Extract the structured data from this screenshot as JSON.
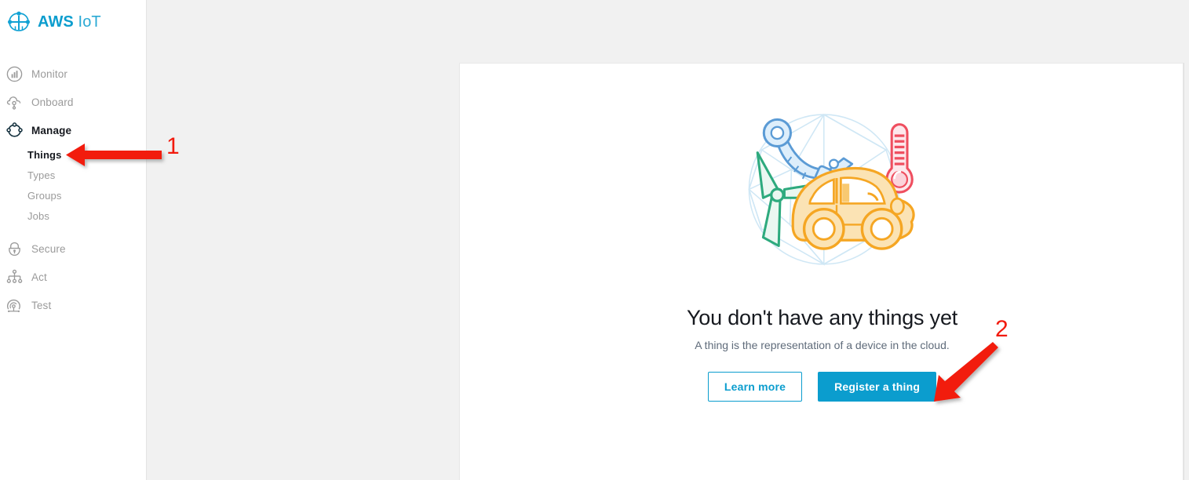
{
  "brand": {
    "logo_icon": "aws-iot-logo-icon",
    "name_primary": "AWS",
    "name_secondary": "IoT",
    "primary_color": "#0b9dce"
  },
  "sidebar": {
    "items": [
      {
        "label": "Monitor",
        "icon": "monitor-chart-icon",
        "active": false
      },
      {
        "label": "Onboard",
        "icon": "onboard-cloud-icon",
        "active": false
      },
      {
        "label": "Manage",
        "icon": "manage-nodes-icon",
        "active": true
      },
      {
        "label": "Secure",
        "icon": "secure-lock-icon",
        "active": false
      },
      {
        "label": "Act",
        "icon": "act-hierarchy-icon",
        "active": false
      },
      {
        "label": "Test",
        "icon": "test-signal-icon",
        "active": false
      }
    ],
    "manage_children": [
      {
        "label": "Things",
        "selected": true
      },
      {
        "label": "Types",
        "selected": false
      },
      {
        "label": "Groups",
        "selected": false
      },
      {
        "label": "Jobs",
        "selected": false
      }
    ]
  },
  "main": {
    "empty_state": {
      "illustration_name": "iot-devices-globe-illustration",
      "title": "You don't have any things yet",
      "subtitle": "A thing is the representation of a device in the cloud.",
      "secondary_button": "Learn more",
      "primary_button": "Register a thing"
    }
  },
  "annotations": {
    "arrow_color": "#f21a0d",
    "markers": [
      {
        "number": "1",
        "target": "Things"
      },
      {
        "number": "2",
        "target": "Register a thing"
      }
    ]
  },
  "colors": {
    "page_background": "#f1f1f1",
    "panel_background": "#ffffff",
    "accent": "#0b9dce",
    "text_dark": "#16191f",
    "text_muted": "#9a9a9a",
    "illustration_globe": "#cfe7f5",
    "illustration_car": "#f5a623",
    "illustration_arm": "#5b9bd5",
    "illustration_turbine": "#2eaa7e",
    "illustration_thermometer": "#ef4e5f"
  }
}
